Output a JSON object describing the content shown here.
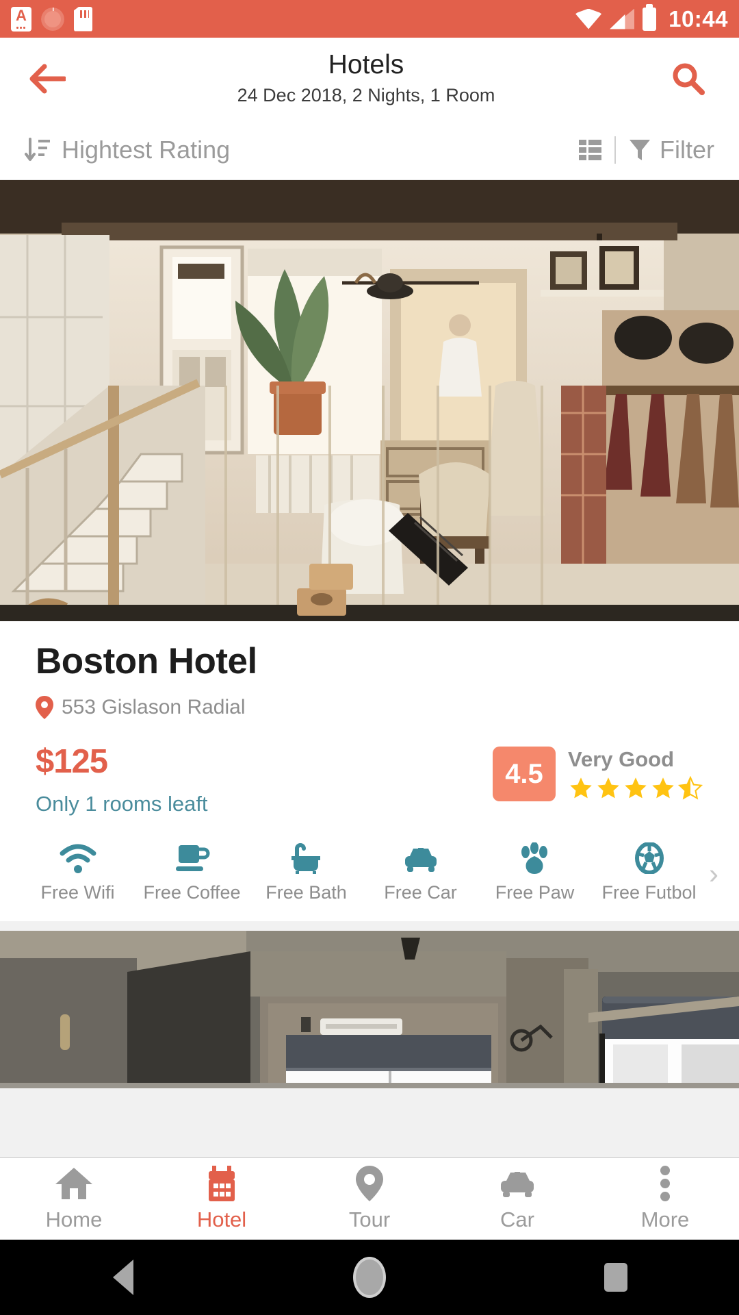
{
  "status_bar": {
    "time": "10:44",
    "left_icons": [
      "app-notification-icon",
      "sync-spinner-icon",
      "sd-card-icon"
    ],
    "right_icons": [
      "wifi-icon",
      "cellular-signal-icon",
      "battery-icon"
    ],
    "background_color": "#e2604b"
  },
  "app_bar": {
    "back_icon": "arrow-left-icon",
    "title": "Hotels",
    "subtitle": "24 Dec 2018, 2 Nights, 1 Room",
    "search_icon": "search-icon"
  },
  "toolbar": {
    "sort_icon": "sort-descending-icon",
    "sort_label": "Hightest Rating",
    "view_toggle_icon": "list-view-icon",
    "filter_icon": "funnel-icon",
    "filter_label": "Filter"
  },
  "hotels": [
    {
      "name": "Boston Hotel",
      "address_icon": "map-pin-icon",
      "address": "553 Gislason Radial",
      "price": "$125",
      "availability": "Only 1 rooms leaft",
      "rating_score": "4.5",
      "rating_word": "Very Good",
      "stars_filled": 4,
      "stars_half": 1,
      "stars_total": 5,
      "amenities": [
        {
          "icon": "wifi-icon",
          "label": "Free Wifi"
        },
        {
          "icon": "coffee-icon",
          "label": "Free Coffee"
        },
        {
          "icon": "bathtub-icon",
          "label": "Free Bath"
        },
        {
          "icon": "car-icon",
          "label": "Free Car"
        },
        {
          "icon": "paw-icon",
          "label": "Free Paw"
        },
        {
          "icon": "football-icon",
          "label": "Free Futbol"
        }
      ],
      "amenities_more_icon": "chevron-right-icon"
    },
    {
      "name": "",
      "address": "",
      "price": "",
      "availability": "",
      "rating_score": "",
      "rating_word": "",
      "amenities": []
    }
  ],
  "bottom_nav": {
    "items": [
      {
        "icon": "home-icon",
        "label": "Home",
        "active": false
      },
      {
        "icon": "building-icon",
        "label": "Hotel",
        "active": true
      },
      {
        "icon": "map-pin-icon",
        "label": "Tour",
        "active": false
      },
      {
        "icon": "car-icon",
        "label": "Car",
        "active": false
      },
      {
        "icon": "more-dots-icon",
        "label": "More",
        "active": false
      }
    ]
  },
  "android_nav": {
    "back_icon": "android-back-icon",
    "home_icon": "android-home-icon",
    "recents_icon": "android-recents-icon"
  },
  "colors": {
    "accent": "#e2604b",
    "rating_badge": "#f5886c",
    "teal": "#4a8c9c",
    "amenity_icon": "#3d8b9b",
    "star": "#ffc312",
    "muted_text": "#9b9b9b"
  }
}
